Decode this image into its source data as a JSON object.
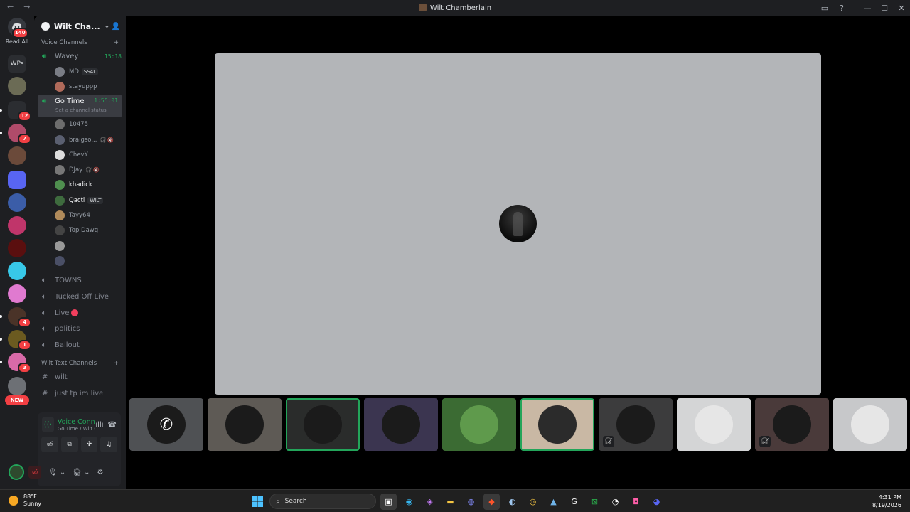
{
  "window": {
    "title": "Wilt Chamberlain"
  },
  "rail": {
    "home_badge": "140",
    "read_all": "Read All",
    "folder_label": "WPs",
    "new_label": "NEW",
    "servers": [
      {
        "badge": "",
        "color": "#6b6b55"
      },
      {
        "badge": "12",
        "color": "#2b2d31"
      },
      {
        "badge": "7",
        "color": "#b04b6a"
      },
      {
        "badge": "",
        "color": "#6b4a3a"
      },
      {
        "badge": "",
        "color": "#5865f2"
      },
      {
        "badge": "",
        "color": "#3b5da8"
      },
      {
        "badge": "",
        "color": "#c0356a"
      },
      {
        "badge": "",
        "color": "#5a0f0f"
      },
      {
        "badge": "",
        "color": "#38c8e8"
      },
      {
        "badge": "",
        "color": "#e07ad0"
      },
      {
        "badge": "4",
        "color": "#4a3328"
      },
      {
        "badge": "1",
        "color": "#6b5a20"
      },
      {
        "badge": "3",
        "color": "#d86aa8"
      },
      {
        "badge": "",
        "color": "#6d7075"
      }
    ]
  },
  "sidebar": {
    "server_name": "Wilt Cha...",
    "voice_category": "Voice Channels",
    "channels": {
      "wavey": {
        "name": "Wavey",
        "timer": "15:18",
        "users": [
          {
            "name": "MD",
            "tag": "SS4L",
            "color": "#7a7d85"
          },
          {
            "name": "stayuppp",
            "color": "#b06a5a"
          }
        ]
      },
      "gotime": {
        "name": "Go Time",
        "timer": "1:55:01",
        "status": "Set a channel status",
        "users": [
          {
            "name": "10475",
            "color": "#6d6d6d",
            "bright": false,
            "icons": ""
          },
          {
            "name": "braigso...",
            "color": "#5a5f70",
            "bright": false,
            "icons": "🎧̸ 🔇"
          },
          {
            "name": "ChevY",
            "color": "#ddd",
            "bright": false,
            "icons": ""
          },
          {
            "name": "DJay",
            "color": "#777",
            "bright": false,
            "icons": "🎧̸ 🔇"
          },
          {
            "name": "khadick",
            "color": "#4f8f4f",
            "bright": true,
            "icons": ""
          },
          {
            "name": "Qacti",
            "color": "#3e6b3e",
            "bright": true,
            "icons": "",
            "tag": "WILT"
          },
          {
            "name": "Tayy64",
            "color": "#b08a5a",
            "bright": false,
            "icons": ""
          },
          {
            "name": "Top Dawg",
            "color": "#444",
            "bright": false,
            "icons": ""
          },
          {
            "name": "",
            "color": "#999",
            "bright": false,
            "icons": ""
          },
          {
            "name": "",
            "color": "#4a4f66",
            "bright": false,
            "icons": ""
          }
        ]
      }
    },
    "other_voice": [
      "TOWNS",
      "Tucked Off Live",
      "Live",
      "politics",
      "Ballout"
    ],
    "text_category": "Wilt Text Channels",
    "text_channels": [
      "wilt",
      "just tp im live"
    ]
  },
  "voice_panel": {
    "status": "Voice Connected",
    "location": "Go Time / Wilt Ch..."
  },
  "stage": {
    "bg": "#b3b5b8"
  },
  "tiles": [
    {
      "name": "tile-phone",
      "bg": "#4f5154",
      "speaking": false,
      "muted": false
    },
    {
      "name": "tile-chain",
      "bg": "#5e5a55",
      "speaking": false,
      "muted": false
    },
    {
      "name": "tile-dark-figure",
      "bg": "#2a2c2b",
      "speaking": true,
      "muted": false
    },
    {
      "name": "tile-hooded",
      "bg": "#3b3550",
      "speaking": false,
      "muted": false
    },
    {
      "name": "tile-cartoon",
      "bg": "#3b6b33",
      "speaking": false,
      "muted": false
    },
    {
      "name": "tile-orange",
      "bg": "#c9b8a4",
      "speaking": true,
      "muted": false
    },
    {
      "name": "tile-bw",
      "bg": "#3c3c3d",
      "speaking": false,
      "muted": true
    },
    {
      "name": "tile-lips",
      "bg": "#d4d5d6",
      "speaking": false,
      "muted": false
    },
    {
      "name": "tile-athlete",
      "bg": "#4a3a3a",
      "speaking": false,
      "muted": true
    },
    {
      "name": "tile-grey",
      "bg": "#c7c8ca",
      "speaking": false,
      "muted": false
    }
  ],
  "taskbar": {
    "temp": "88°F",
    "condition": "Sunny",
    "search": "Search",
    "time": "4:31 PM",
    "date": "8/19/2026"
  }
}
